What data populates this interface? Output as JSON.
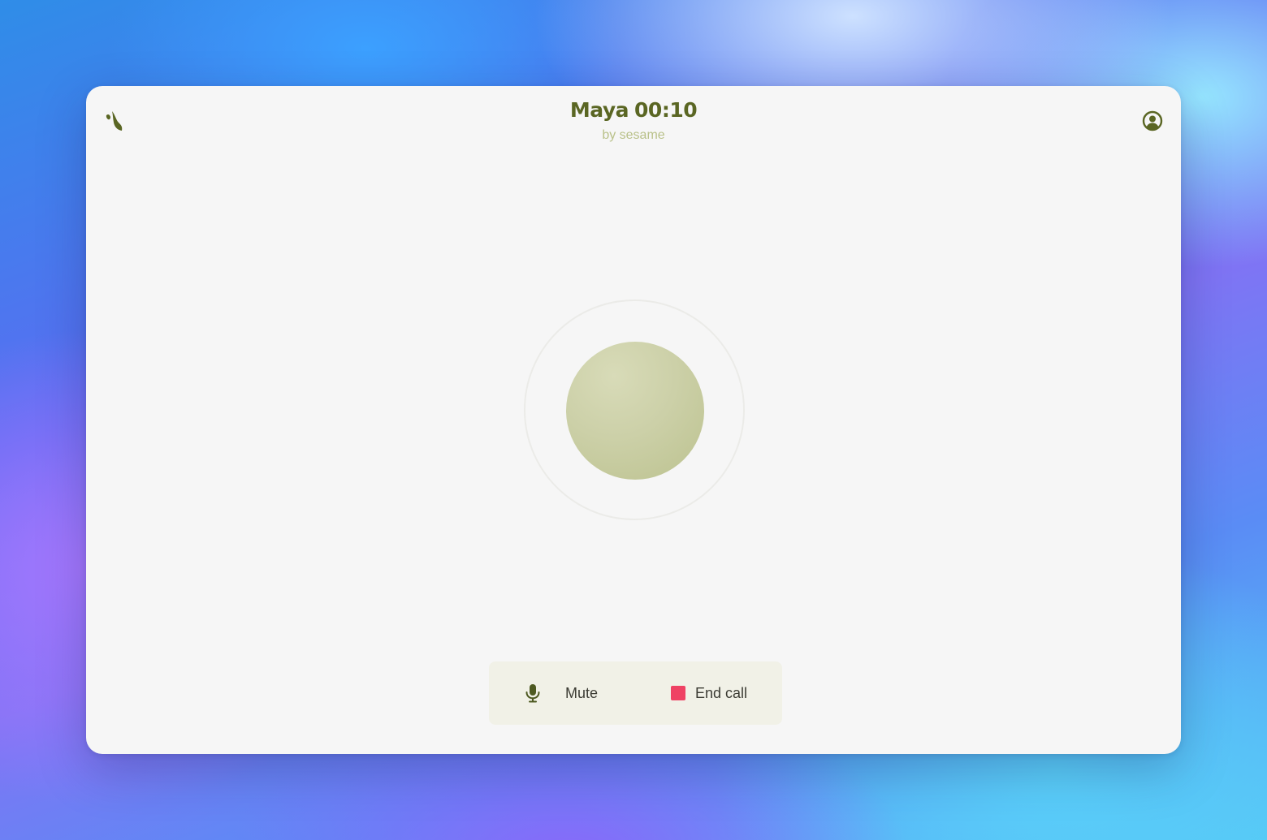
{
  "header": {
    "agent_name": "Maya",
    "call_timer": "00:10",
    "subtitle": "by sesame",
    "logo_icon": "leaf-logo-icon",
    "account_icon": "user-circle-icon"
  },
  "controls": {
    "mute_label": "Mute",
    "mute_icon": "microphone-icon",
    "end_call_label": "End call",
    "end_call_icon": "stop-square-icon"
  },
  "colors": {
    "brand_olive": "#5a6623",
    "subtitle": "#b9c189",
    "orb": "#ccd0a8",
    "end_call_red": "#ef4264",
    "controls_bg": "#f1f1e7",
    "window_bg": "#f6f6f6"
  }
}
